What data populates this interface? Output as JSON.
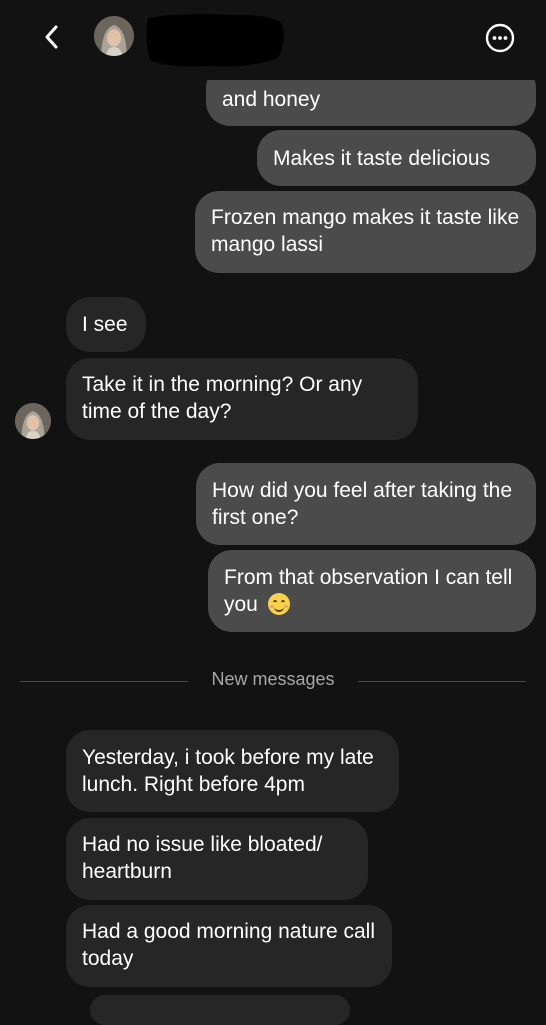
{
  "header": {
    "back_icon": "chevron-left-icon",
    "more_icon": "more-options-icon"
  },
  "messages": {
    "m1": "and honey",
    "m2": "Makes it taste delicious",
    "m3": "Frozen mango makes it taste like mango lassi",
    "m4": "I see",
    "m5": "Take it in the morning? Or any time of the day?",
    "m6": "How did you feel after taking the first one?",
    "m7": "From that observation I can tell you",
    "m8": "Yesterday, i took before my late lunch. Right before 4pm",
    "m9": "Had no issue like bloated/ heartburn",
    "m10": "Had a good morning nature call today"
  },
  "divider": {
    "label": "New messages"
  },
  "emoji": "smiling-face-icon",
  "colors": {
    "background": "#121212",
    "outgoing_bubble": "#4b4b4b",
    "incoming_bubble": "#262626",
    "divider_text": "#a7a7a7"
  }
}
